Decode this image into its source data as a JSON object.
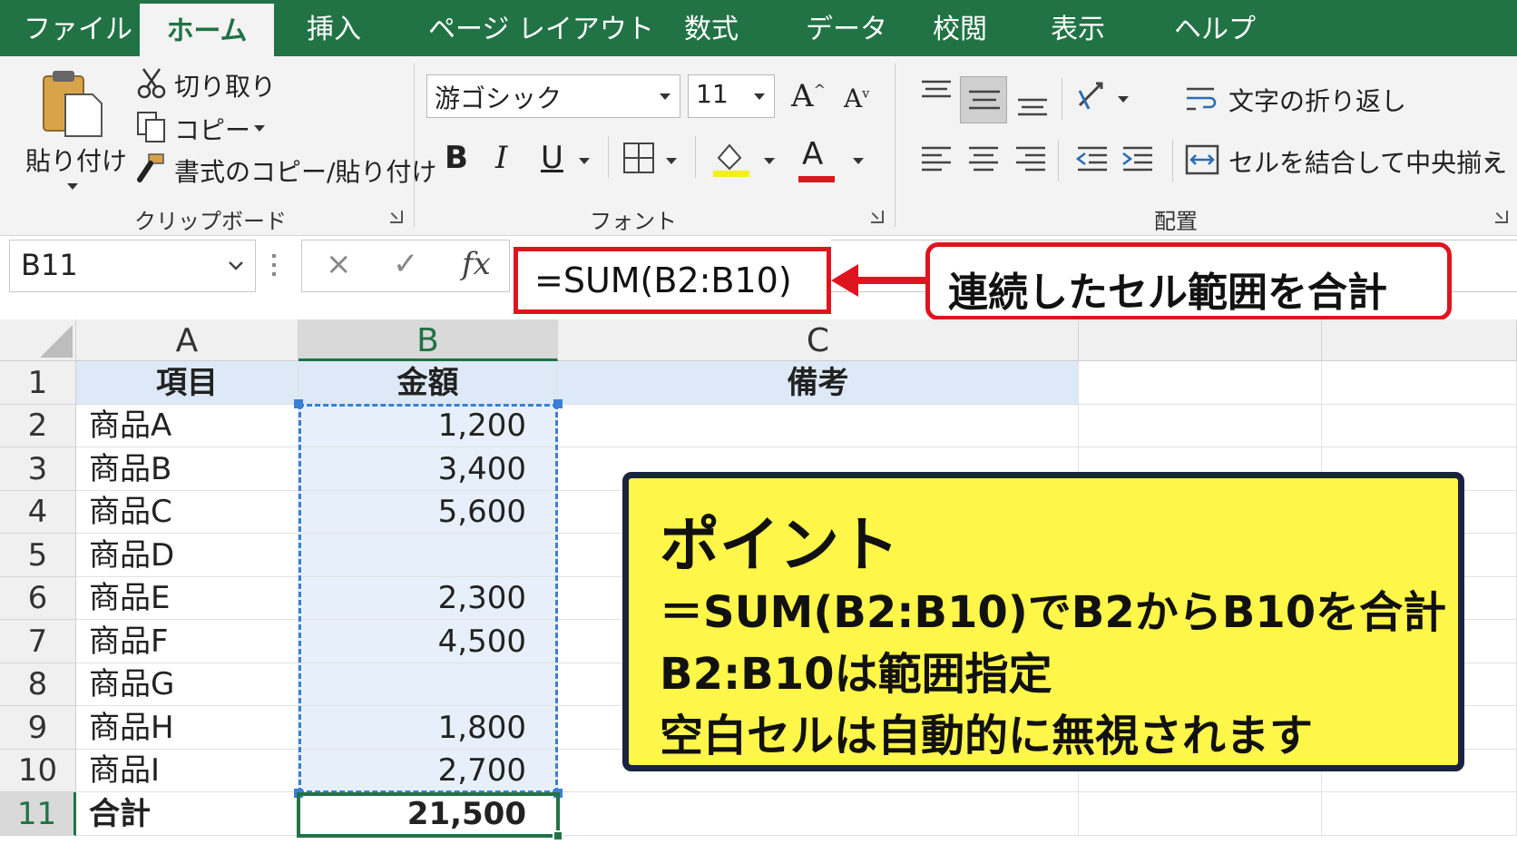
{
  "tabs": [
    "ファイル",
    "ホーム",
    "挿入",
    "ページ レイアウト",
    "数式",
    "データ",
    "校閲",
    "表示",
    "ヘルプ"
  ],
  "ribbon": {
    "clipboard": {
      "paste_label": "貼り付け",
      "cut_label": "切り取り",
      "copy_label": "コピー",
      "format_painter_label": "書式のコピー/貼り付け",
      "group_label": "クリップボード"
    },
    "font": {
      "font_name": "游ゴシック",
      "font_size": "11",
      "grow_label": "A",
      "shrink_label": "A",
      "bold_label": "B",
      "italic_label": "I",
      "underline_label": "U",
      "font_color_label": "A",
      "group_label": "フォント"
    },
    "alignment": {
      "wrap_text_label": "文字の折り返し",
      "merge_center_label": "セルを結合して中央揃え",
      "group_label": "配置"
    }
  },
  "formula_bar": {
    "name_box": "B11",
    "cancel_symbol": "×",
    "enter_symbol": "✓",
    "fx_symbol": "fx",
    "formula": "=SUM(B2:B10)"
  },
  "callout": "連続したセル範囲を合計",
  "sheet": {
    "columns": [
      "A",
      "B",
      "C"
    ],
    "rows": [
      "1",
      "2",
      "3",
      "4",
      "5",
      "6",
      "7",
      "8",
      "9",
      "10",
      "11"
    ],
    "header": {
      "a": "項目",
      "b": "金額",
      "c": "備考"
    },
    "data": [
      {
        "a": "商品A",
        "b": "1,200"
      },
      {
        "a": "商品B",
        "b": "3,400"
      },
      {
        "a": "商品C",
        "b": "5,600"
      },
      {
        "a": "商品D",
        "b": ""
      },
      {
        "a": "商品E",
        "b": "2,300"
      },
      {
        "a": "商品F",
        "b": "4,500"
      },
      {
        "a": "商品G",
        "b": ""
      },
      {
        "a": "商品H",
        "b": "1,800"
      },
      {
        "a": "商品I",
        "b": "2,700"
      }
    ],
    "total": {
      "a": "合計",
      "b": "21,500"
    }
  },
  "point_box": {
    "title": "ポイント",
    "lines": [
      "＝SUM(B2:B10)でB2からB10を合計",
      "B2:B10は範囲指定",
      "空白セルは自動的に無視されます"
    ]
  },
  "colors": {
    "excel_green": "#217346",
    "highlight_red": "#e0141e",
    "point_yellow": "#fff64a",
    "range_blue": "#3a7fd6"
  }
}
